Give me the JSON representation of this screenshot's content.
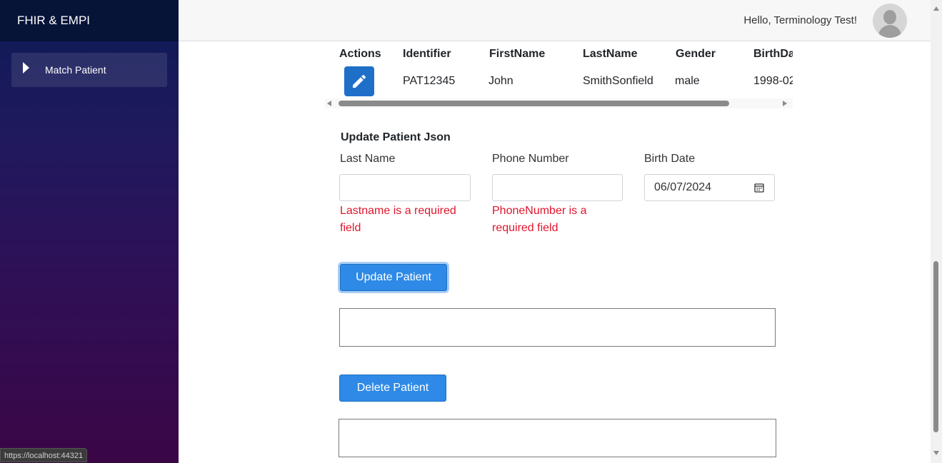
{
  "app": {
    "brand": "FHIR & EMPI",
    "greeting": "Hello, Terminology Test!",
    "status_url": "https://localhost:44321"
  },
  "sidebar": {
    "items": [
      {
        "label": "Match Patient",
        "icon": "caret-right-icon"
      }
    ]
  },
  "table": {
    "headers": [
      "Actions",
      "Identifier",
      "FirstName",
      "LastName",
      "Gender",
      "BirthDa"
    ],
    "rows": [
      {
        "identifier": "PAT12345",
        "first_name": "John",
        "last_name": "SmithSonfield",
        "gender": "male",
        "birth_date": "1998-02",
        "action_icon": "pencil-icon"
      }
    ]
  },
  "form": {
    "title": "Update Patient Json",
    "last_name_label": "Last Name",
    "last_name_value": "",
    "last_name_error": "Lastname is a required field",
    "phone_label": "Phone Number",
    "phone_value": "",
    "phone_error": "PhoneNumber is a required field",
    "birth_label": "Birth Date",
    "birth_value": "06/07/2024",
    "update_button": "Update Patient",
    "delete_button": "Delete Patient"
  },
  "colors": {
    "primary_button": "#2e8ae6",
    "edit_button": "#1f6fc9",
    "error_text": "#e0152d",
    "sidebar_top": "#0c1a55",
    "sidebar_bottom": "#3a0646",
    "brand_bar": "#061438"
  }
}
